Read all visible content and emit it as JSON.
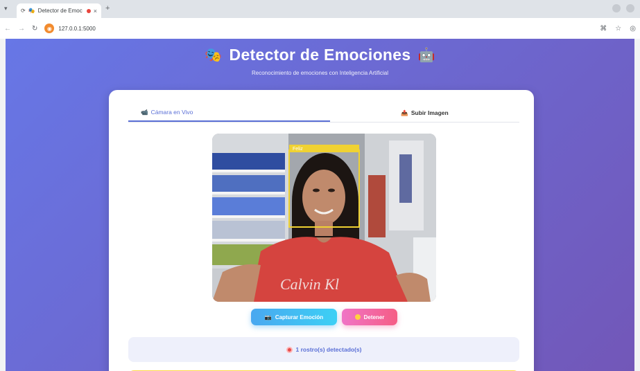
{
  "browser": {
    "tab_title": "Detector de Emoc",
    "url": "127.0.0.1:5000"
  },
  "header": {
    "title": "Detector de Emociones",
    "subtitle": "Reconocimiento de emociones con Inteligencia Artificial"
  },
  "tabs": [
    {
      "label": "Cámara en Vivo",
      "active": true,
      "icon": "video-camera-icon"
    },
    {
      "label": "Subir Imagen",
      "active": false,
      "icon": "upload-icon"
    }
  ],
  "video": {
    "face_label": "Feliz",
    "shirt_text": "Calvin Kl"
  },
  "buttons": {
    "capture_label": "Capturar Emoción",
    "stop_label": "Detener"
  },
  "status": {
    "faces_detected": "1 rostro(s) detectado(s)"
  },
  "colors": {
    "accent": "#5a6fd6",
    "gradient_start": "#6777e6",
    "gradient_end": "#7257b8",
    "face_box": "#f0d232"
  }
}
